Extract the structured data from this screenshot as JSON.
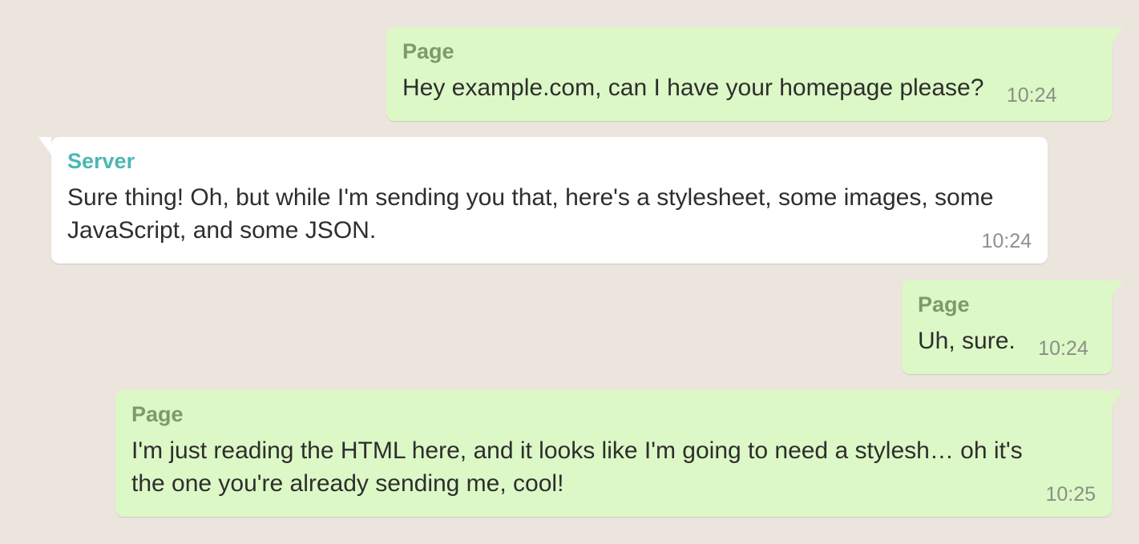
{
  "colors": {
    "background": "#ece5dd",
    "page_bubble": "#dcf8c6",
    "server_bubble": "#ffffff",
    "page_sender": "#7c9a6b",
    "server_sender": "#4db6b2"
  },
  "messages": [
    {
      "sender": "Page",
      "text": "Hey example.com, can I have your homepage please?",
      "time": "10:24"
    },
    {
      "sender": "Server",
      "text": "Sure thing! Oh, but while I'm sending you that, here's a stylesheet, some images, some JavaScript, and some JSON.",
      "time": "10:24"
    },
    {
      "sender": "Page",
      "text": "Uh, sure.",
      "time": "10:24"
    },
    {
      "sender": "Page",
      "text": "I'm just reading the HTML here, and it looks like I'm going to need a stylesh… oh it's the one you're already sending me, cool!",
      "time": "10:25"
    }
  ]
}
